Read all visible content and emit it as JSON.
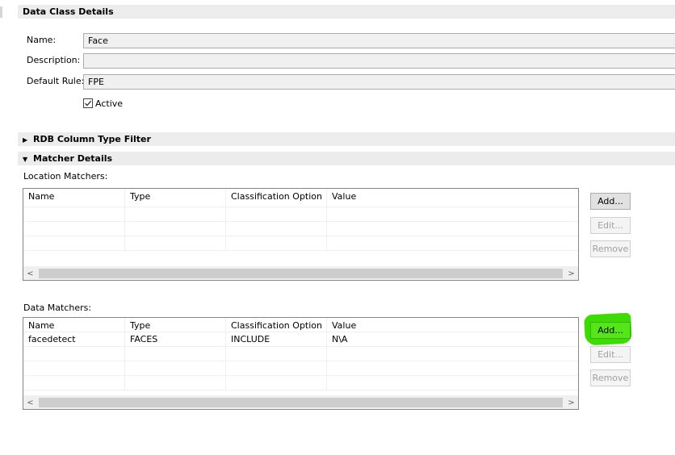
{
  "details": {
    "header": "Data Class Details",
    "name_label": "Name:",
    "name_value": "Face",
    "description_label": "Description:",
    "description_value": "",
    "default_rule_label": "Default Rule:",
    "default_rule_value": "FPE",
    "active_label": "Active",
    "active_checked": true
  },
  "rdb_filter": {
    "header": "RDB Column Type Filter",
    "expanded": false
  },
  "matcher_details": {
    "header": "Matcher Details",
    "expanded": true,
    "location": {
      "label": "Location Matchers:",
      "columns": [
        "Name",
        "Type",
        "Classification Option",
        "Value"
      ],
      "rows": [],
      "buttons": {
        "add": "Add...",
        "edit": "Edit...",
        "remove": "Remove"
      }
    },
    "data": {
      "label": "Data Matchers:",
      "columns": [
        "Name",
        "Type",
        "Classification Option",
        "Value"
      ],
      "rows": [
        {
          "name": "facedetect",
          "type": "FACES",
          "option": "INCLUDE",
          "value": "N\\A"
        }
      ],
      "buttons": {
        "add": "Add...",
        "edit": "Edit...",
        "remove": "Remove"
      }
    }
  },
  "scroll": {
    "left_arrow": "<",
    "right_arrow": ">"
  },
  "colors": {
    "highlight": "#3ddc00",
    "header_bg": "#ececec"
  }
}
